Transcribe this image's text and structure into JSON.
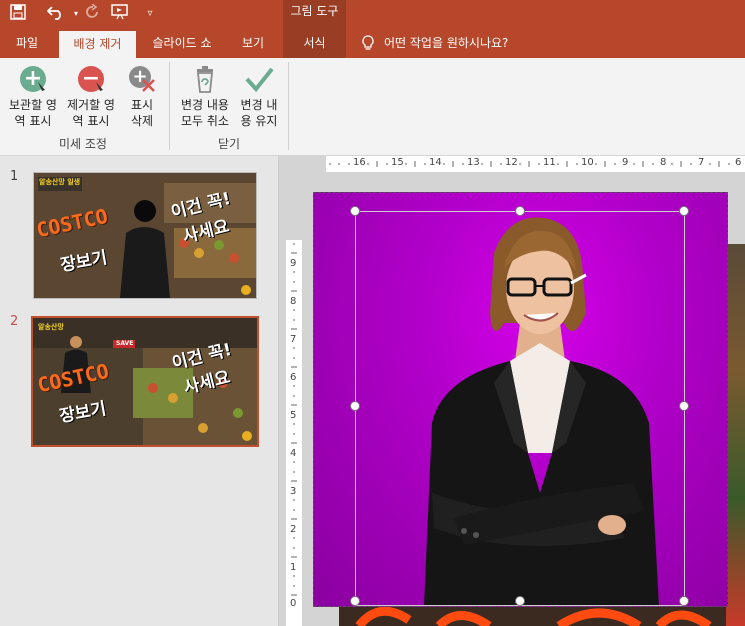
{
  "title_bar": {
    "context_group": "그림 도구",
    "quick_access": [
      "save-icon",
      "undo-icon",
      "redo-icon",
      "start-from-beginning-icon",
      "customize-qat-icon"
    ]
  },
  "tabs": {
    "file": "파일",
    "background_removal": "배경 제거",
    "slide_show": "슬라이드 쇼",
    "view": "보기",
    "format": "서식",
    "tell_me": "어떤 작업을 원하시나요?"
  },
  "ribbon": {
    "keep_line1": "보관할 영",
    "keep_line2": "역 표시",
    "remove_line1": "제거할 영",
    "remove_line2": "역 표시",
    "delete_line1": "표시",
    "delete_line2": "삭제",
    "refine_group": "미세 조정",
    "discard_line1": "변경 내용",
    "discard_line2": "모두 취소",
    "keep_changes_line1": "변경 내",
    "keep_changes_line2": "용 유지",
    "close_group": "닫기"
  },
  "slides": [
    {
      "number": "1",
      "small_label": "알송산망 일생",
      "brand": "COSTCO",
      "sub": "장보기",
      "line1": "이건 꼭!",
      "line2": "사세요"
    },
    {
      "number": "2",
      "small_label": "알송산망",
      "brand": "COSTCO",
      "sub": "장보기",
      "line1": "이건 꼭!",
      "line2": "사세요",
      "sign": "SAVE"
    }
  ],
  "rulers": {
    "horizontal": [
      "16",
      "15",
      "14",
      "13",
      "12",
      "11",
      "10",
      "9",
      "8",
      "7",
      "6"
    ],
    "vertical": [
      "9",
      "8",
      "7",
      "6",
      "5",
      "4",
      "3",
      "2",
      "1",
      "0"
    ]
  },
  "colors": {
    "accent": "#b7472a",
    "magenta": "#b000c8",
    "keep_green": "#6bab90",
    "remove_red": "#d9534f"
  }
}
